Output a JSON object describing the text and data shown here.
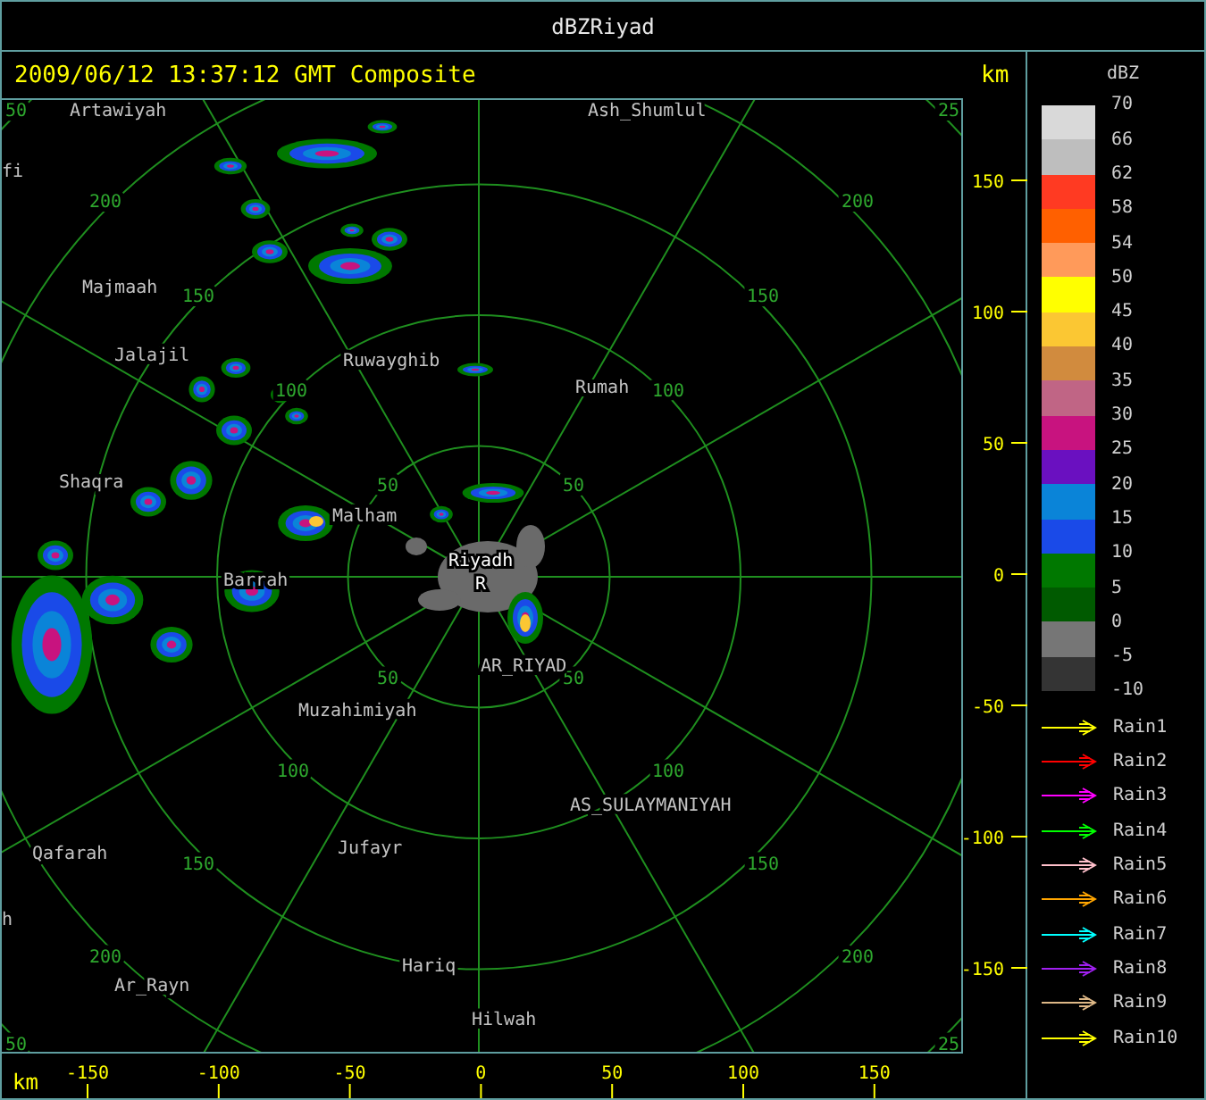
{
  "window": {
    "title": "dBZRiyad"
  },
  "header": {
    "timestamp": "2009/06/12 13:37:12 GMT Composite"
  },
  "map": {
    "range_labels": [
      "50",
      "25",
      "200",
      "200",
      "150",
      "150",
      "100",
      "100",
      "50",
      "50",
      "50",
      "50",
      "100",
      "100",
      "150",
      "150",
      "200",
      "200",
      "50",
      "25"
    ],
    "places": [
      "Artawiyah",
      "Ash_Shumlul",
      "fi",
      "Majmaah",
      "Jalajil",
      "Ruwayghib",
      "Rumah",
      "Shaqra",
      "Malham",
      "Barrah",
      "AR_RIYAD",
      "Muzahimiyah",
      "AS_SULAYMANIYAH",
      "Jufayr",
      "Qafarah",
      "h",
      "Hariq",
      "Ar_Rayn",
      "Hilwah"
    ],
    "site": {
      "name": "Riyadh",
      "marker": "R"
    }
  },
  "y_axis": {
    "unit": "km",
    "ticks": [
      "150",
      "100",
      "50",
      "0",
      "-50",
      "-100",
      "-150"
    ]
  },
  "x_axis": {
    "unit": "km",
    "ticks": [
      "-150",
      "-100",
      "-50",
      "0",
      "50",
      "100",
      "150"
    ]
  },
  "legend": {
    "title": "dBZ",
    "ticks": [
      "70",
      "66",
      "62",
      "58",
      "54",
      "50",
      "45",
      "40",
      "35",
      "30",
      "25",
      "20",
      "15",
      "10",
      "5",
      "0",
      "-5",
      "-10"
    ],
    "bins": [
      {
        "color": "#d9d9d9"
      },
      {
        "color": "#bebebe"
      },
      {
        "color": "#ff3a22"
      },
      {
        "color": "#ff6000"
      },
      {
        "color": "#ff9a5a"
      },
      {
        "color": "#ffff00"
      },
      {
        "color": "#fbc733"
      },
      {
        "color": "#d18b3e"
      },
      {
        "color": "#c06585"
      },
      {
        "color": "#c8137f"
      },
      {
        "color": "#6a10c0"
      },
      {
        "color": "#0a84d8"
      },
      {
        "color": "#1a4ae8"
      },
      {
        "color": "#007800"
      },
      {
        "color": "#005a00"
      },
      {
        "color": "#767676"
      },
      {
        "color": "#343434"
      }
    ]
  },
  "tracks": [
    {
      "label": "Rain1",
      "color": "#ffff00"
    },
    {
      "label": "Rain2",
      "color": "#ff0000"
    },
    {
      "label": "Rain3",
      "color": "#ff00ff"
    },
    {
      "label": "Rain4",
      "color": "#00ff00"
    },
    {
      "label": "Rain5",
      "color": "#ffc0cb"
    },
    {
      "label": "Rain6",
      "color": "#ffa500"
    },
    {
      "label": "Rain7",
      "color": "#00ffff"
    },
    {
      "label": "Rain8",
      "color": "#a020f0"
    },
    {
      "label": "Rain9",
      "color": "#deb887"
    },
    {
      "label": "Rain10",
      "color": "#ffff00"
    }
  ]
}
